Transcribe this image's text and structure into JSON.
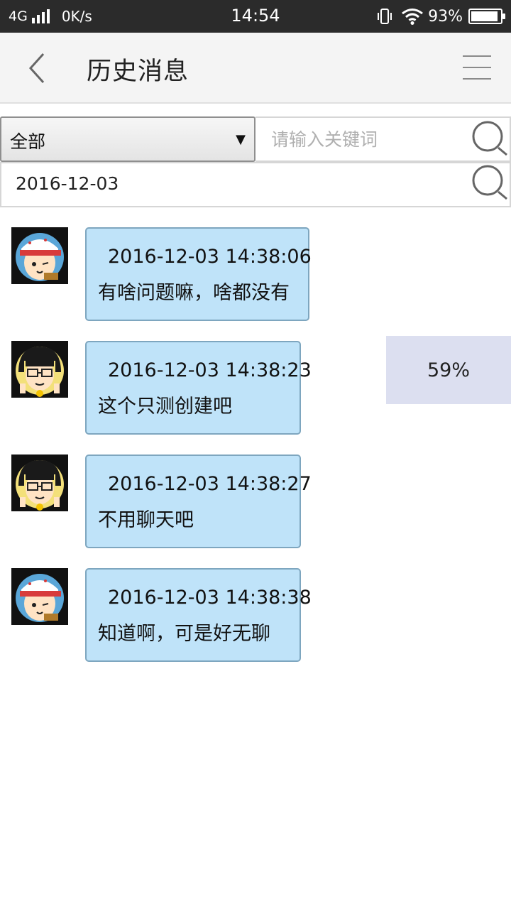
{
  "status_bar": {
    "network": "4G",
    "speed": "0K/s",
    "time": "14:54",
    "battery_text": "93%",
    "battery_level": 0.93,
    "icons": [
      "signal-icon",
      "vibrate-icon",
      "wifi-icon",
      "battery-icon"
    ]
  },
  "header": {
    "title": "历史消息",
    "back_icon": "chevron-left-icon",
    "menu_icon": "hamburger-menu-icon"
  },
  "filter": {
    "type_selected": "全部",
    "keyword_placeholder": "请输入关键词",
    "keyword_value": "",
    "date_value": "2016-12-03"
  },
  "messages": [
    {
      "avatar": "boy-with-cap-avatar",
      "time": "2016-12-03 14:38:06",
      "text": "有啥问题嘛，啥都没有"
    },
    {
      "avatar": "girl-with-glasses-avatar",
      "time": "2016-12-03 14:38:23",
      "text": "这个只测创建吧"
    },
    {
      "avatar": "girl-with-glasses-avatar",
      "time": "2016-12-03 14:38:27",
      "text": "不用聊天吧"
    },
    {
      "avatar": "boy-with-cap-avatar",
      "time": "2016-12-03 14:38:38",
      "text": "知道啊，可是好无聊"
    }
  ],
  "progress": {
    "label": "59%",
    "value": 0.59
  },
  "colors": {
    "status_bar_bg": "#2b2b2b",
    "header_bg": "#f4f4f4",
    "bubble_bg": "#bfe3f9",
    "bubble_border": "#7ea6bf",
    "progress_bg": "#dcdff0"
  }
}
